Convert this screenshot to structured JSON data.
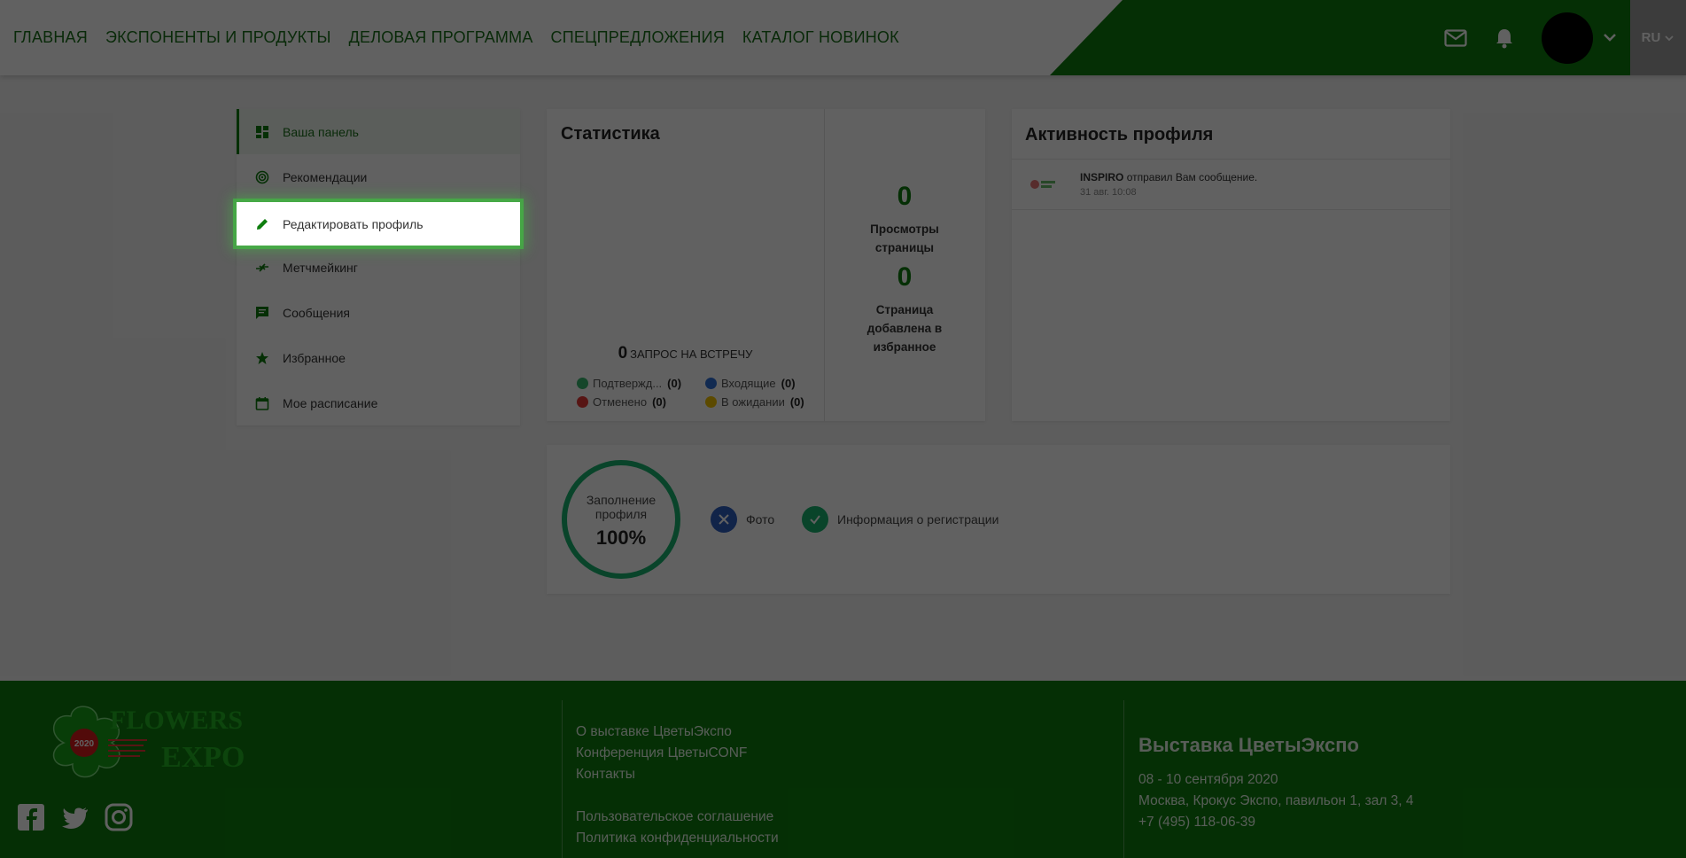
{
  "nav": {
    "items": [
      "ГЛАВНАЯ",
      "ЭКСПОНЕНТЫ И ПРОДУКТЫ",
      "ДЕЛОВАЯ ПРОГРАММА",
      "СПЕЦПРЕДЛОЖЕНИЯ",
      "КАТАЛОГ НОВИНОК"
    ]
  },
  "header": {
    "lang": "RU",
    "icons": [
      "mail-icon",
      "bell-icon",
      "avatar",
      "chevron-down-icon"
    ]
  },
  "sidebar": {
    "items": [
      {
        "label": "Ваша панель",
        "icon": "dashboard-icon"
      },
      {
        "label": "Рекомендации",
        "icon": "radar-icon"
      },
      {
        "label": "Редактировать профиль",
        "icon": "pencil-icon"
      },
      {
        "label": "Метчмейкинг",
        "icon": "swap-icon"
      },
      {
        "label": "Сообщения",
        "icon": "chat-icon"
      },
      {
        "label": "Избранное",
        "icon": "star-icon"
      },
      {
        "label": "Мое расписание",
        "icon": "calendar-icon"
      }
    ]
  },
  "stats": {
    "title": "Статистика",
    "requests_count": "0",
    "requests_label": "ЗАПРОС НА ВСТРЕЧУ",
    "legend": [
      {
        "label": "Подтвержд...",
        "value": "(0)",
        "color": "#39b86e"
      },
      {
        "label": "Входящие",
        "value": "(0)",
        "color": "#2f6fd6"
      },
      {
        "label": "Отменено",
        "value": "(0)",
        "color": "#e53935"
      },
      {
        "label": "В ожидании",
        "value": "(0)",
        "color": "#f2c200"
      }
    ],
    "views_num": "0",
    "views_label_1": "Просмотры",
    "views_label_2": "страницы",
    "fav_num": "0",
    "fav_label_1": "Страница",
    "fav_label_2": "добавлена в",
    "fav_label_3": "избранное"
  },
  "activity": {
    "title": "Активность профиля",
    "item_sender": "INSPIRO",
    "item_text": "отправил Вам сообщение.",
    "item_time": "31 авг. 10:08"
  },
  "fill": {
    "label_1": "Заполнение",
    "label_2": "профиля",
    "percent": "100%",
    "checks": [
      {
        "label": "Фото",
        "status": "missing",
        "color": "#2f5fbf"
      },
      {
        "label": "Информация о регистрации",
        "status": "done",
        "color": "#1ab46e"
      }
    ]
  },
  "footer": {
    "logo_text_1": "FLOWERS",
    "logo_text_2": "EXPO",
    "logo_year": "2020",
    "links_a": [
      "О выставке ЦветыЭкспо",
      "Конференция ЦветыCONF",
      "Контакты"
    ],
    "links_b": [
      "Пользовательское соглашение",
      "Политика конфиденциальности"
    ],
    "title": "Выставка ЦветыЭкспо",
    "dates": "08 - 10 сентября 2020",
    "address": "Москва, Крокус Экспо, павильон 1, зал 3, 4",
    "phone": "+7 (495) 118-06-39"
  },
  "colors": {
    "brand_green": "#0e7d0e",
    "highlight": "#3cc83c"
  }
}
